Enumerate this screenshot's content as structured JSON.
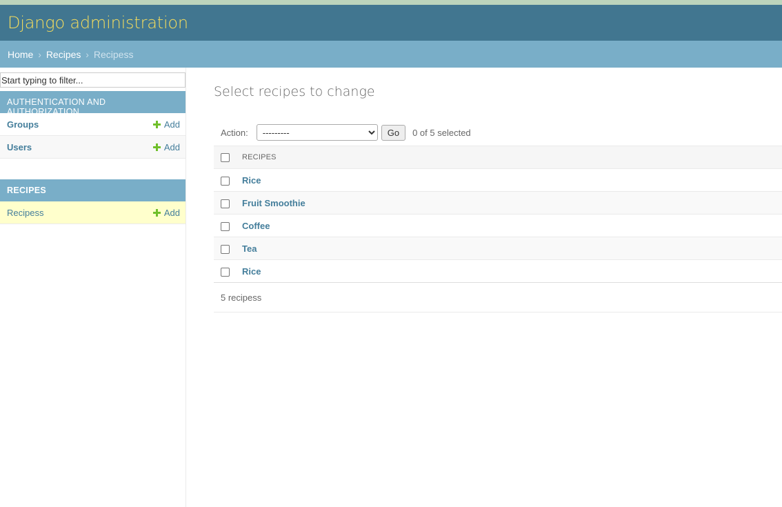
{
  "header": {
    "site_title": "Django administration"
  },
  "breadcrumbs": {
    "home": "Home",
    "app": "Recipes",
    "current": "Recipess",
    "separator": "›"
  },
  "sidebar": {
    "filter_placeholder": "Start typing to filter...",
    "apps": [
      {
        "caption": "AUTHENTICATION AND AUTHORIZATION",
        "models": [
          {
            "label": "Groups",
            "add": "Add"
          },
          {
            "label": "Users",
            "add": "Add"
          }
        ]
      },
      {
        "caption": "RECIPES",
        "models": [
          {
            "label": "Recipess",
            "add": "Add"
          }
        ]
      }
    ]
  },
  "content": {
    "title": "Select recipes to change",
    "actions": {
      "label": "Action:",
      "selected_option": "---------",
      "go": "Go",
      "selection_counter": "0 of 5 selected"
    },
    "table": {
      "column_header": "RECIPES",
      "rows": [
        "Rice",
        "Fruit Smoothie",
        "Coffee",
        "Tea",
        "Rice"
      ]
    },
    "paginator": "5 recipess"
  },
  "colors": {
    "header_bg": "#417690",
    "site_title": "#f5dd5d",
    "breadcrumb_bg": "#79aec8",
    "link": "#447e9b",
    "add_plus": "#70bf2b",
    "selected_row": "#ffffcc"
  }
}
